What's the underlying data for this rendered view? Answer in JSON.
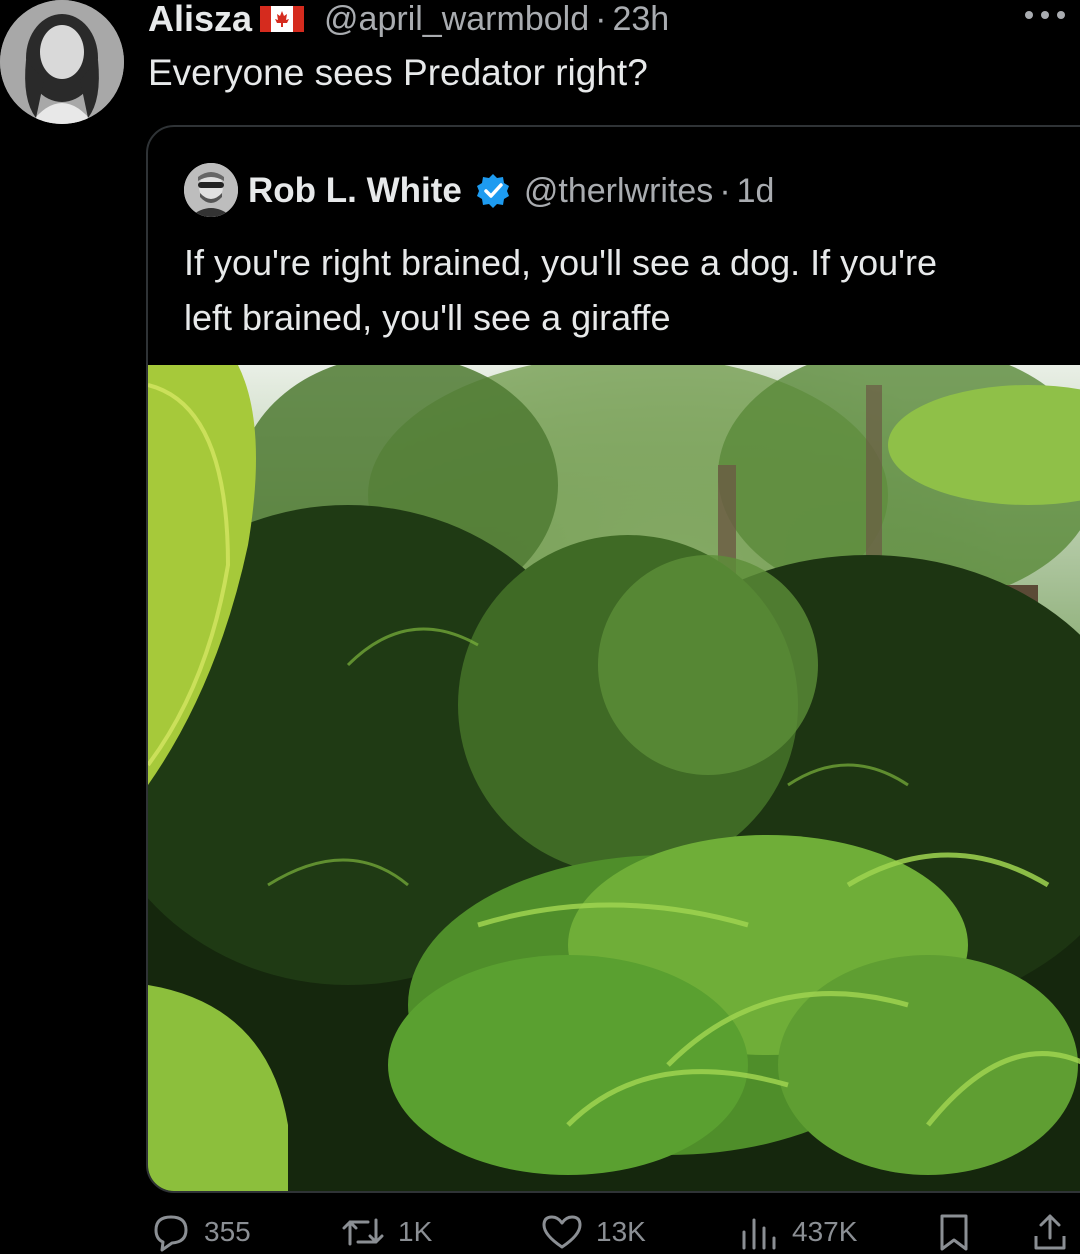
{
  "post": {
    "author": {
      "display_name": "Alisza",
      "flag_icon": "canada-flag-icon",
      "handle": "@april_warmbold",
      "separator": "·",
      "time": "23h"
    },
    "text": "Everyone sees Predator right?",
    "more_icon": "more-icon"
  },
  "quote": {
    "author": {
      "display_name": "Rob L. White",
      "verified_icon": "verified-badge-icon",
      "verified_color": "#1d9bf0",
      "handle": "@therlwrites",
      "separator": "·",
      "time": "1d"
    },
    "text": "If you're right brained, you'll see a dog. If you're left brained, you'll see a giraffe",
    "image_icon": "jungle-photo"
  },
  "actions": {
    "replies": "355",
    "reposts": "1K",
    "likes": "13K",
    "views": "437K",
    "bookmark_icon": "bookmark-icon",
    "share_icon": "share-icon"
  },
  "colors": {
    "background": "#000000",
    "text": "#e7e9ea",
    "secondary_text": "#a9acb0",
    "border": "#2f3336",
    "action_icons": "#8b8f94"
  }
}
